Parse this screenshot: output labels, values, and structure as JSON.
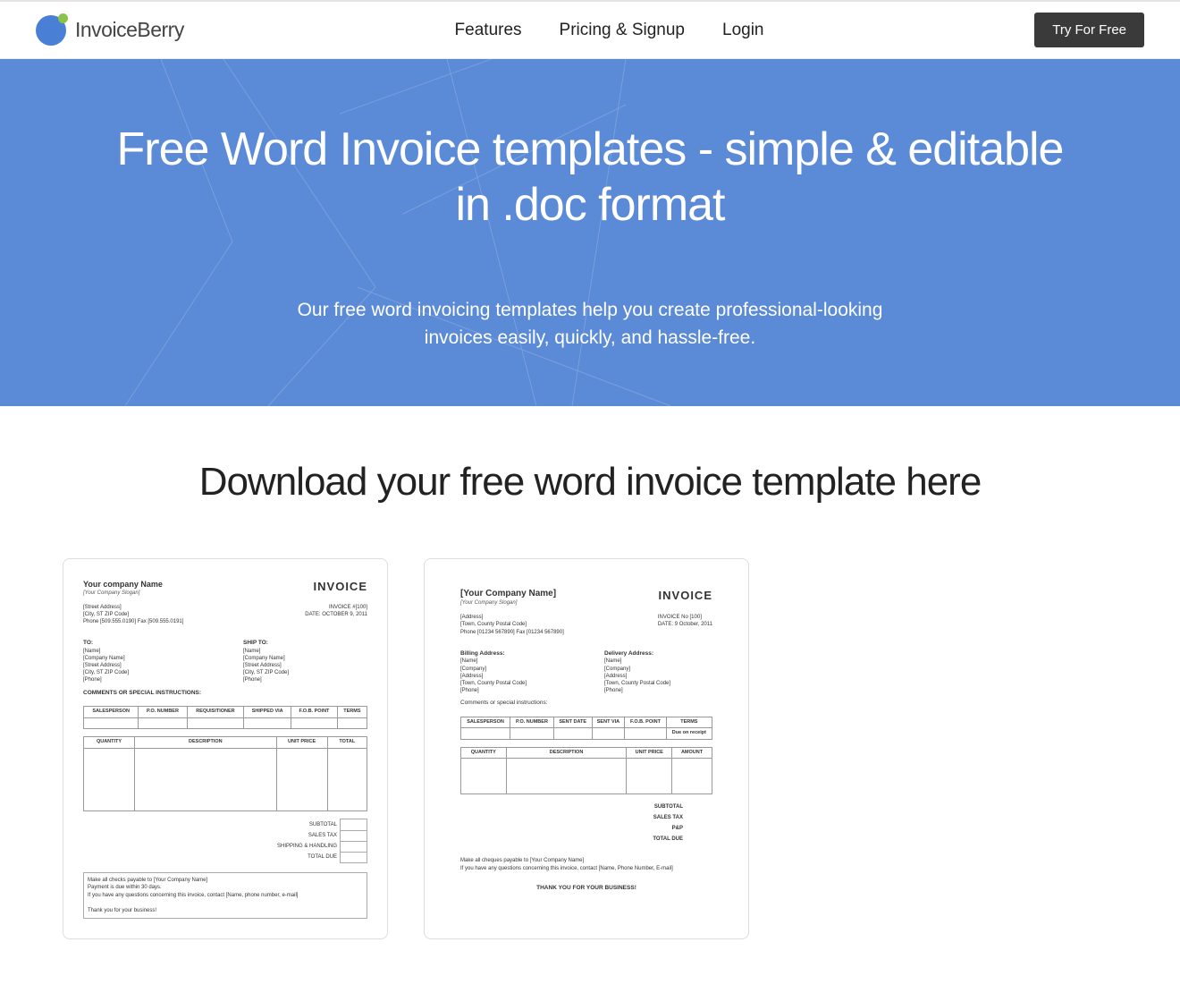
{
  "brand": {
    "name": "InvoiceBerry"
  },
  "nav": {
    "features": "Features",
    "pricing": "Pricing & Signup",
    "login": "Login",
    "cta": "Try For Free"
  },
  "hero": {
    "title": "Free Word Invoice templates - simple & editable in .doc format",
    "subtitle": "Our free word invoicing templates help you create professional-looking invoices easily, quickly, and hassle-free."
  },
  "section": {
    "heading": "Download your free word invoice template here"
  },
  "template1": {
    "company_name": "Your company Name",
    "slogan": "[Your Company Slogan]",
    "addr1": "[Street Address]",
    "addr2": "[City, ST  ZIP Code]",
    "phone_fax": "Phone [509.555.0190]  Fax [509.555.0191]",
    "invoice_word": "INVOICE",
    "invoice_no_label": "INVOICE #[100]",
    "date_label": "DATE: OCTOBER 9, 2011",
    "to_label": "TO:",
    "ship_label": "SHIP TO:",
    "field_name": "[Name]",
    "field_company": "[Company Name]",
    "field_street": "[Street Address]",
    "field_city": "[City, ST  ZIP Code]",
    "field_phone": "[Phone]",
    "comments_label": "COMMENTS OR SPECIAL INSTRUCTIONS:",
    "th_sales": "SALESPERSON",
    "th_po": "P.O. NUMBER",
    "th_req": "REQUISITIONER",
    "th_ship": "SHIPPED VIA",
    "th_fob": "F.O.B. POINT",
    "th_terms": "TERMS",
    "th_qty": "QUANTITY",
    "th_desc": "DESCRIPTION",
    "th_unit": "UNIT PRICE",
    "th_total": "TOTAL",
    "tot_sub": "SUBTOTAL",
    "tot_tax": "SALES TAX",
    "tot_ship": "SHIPPING & HANDLING",
    "tot_due": "TOTAL DUE",
    "foot1": "Make all checks payable to [Your Company Name]",
    "foot2": "Payment is due within 30 days.",
    "foot3": "If you have any questions concerning this invoice, contact [Name, phone number, e-mail]",
    "foot4": "Thank you for your business!"
  },
  "template2": {
    "company_name": "[Your Company Name]",
    "slogan": "[Your Company Slogan]",
    "addr_label": "[Address]",
    "town": "[Town, County  Postal Code]",
    "phone_fax": "Phone [01234 567890] Fax [01234 567890]",
    "invoice_word": "INVOICE",
    "invoice_no_label": "INVOICE No [100]",
    "date_label": "DATE:  9 October, 2011",
    "bill_label": "Billing Address:",
    "deliv_label": "Delivery Address:",
    "field_name": "[Name]",
    "field_company": "[Company]",
    "field_address": "[Address]",
    "field_town": "[Town, County  Postal Code]",
    "field_phone": "[Phone]",
    "comments_label": "Comments or special instructions:",
    "th_sales": "SALESPERSON",
    "th_po": "P.O. NUMBER",
    "th_sent_date": "SENT DATE",
    "th_sent_via": "SENT VIA",
    "th_fob": "F.O.B. POINT",
    "th_terms": "TERMS",
    "terms_value": "Due on receipt",
    "th_qty": "QUANTITY",
    "th_desc": "DESCRIPTION",
    "th_unit": "UNIT PRICE",
    "th_amount": "AMOUNT",
    "tot_sub": "SUBTOTAL",
    "tot_tax": "SALES TAX",
    "tot_pp": "P&P",
    "tot_due": "TOTAL DUE",
    "foot1": "Make all cheques payable to [Your Company Name]",
    "foot2": "If you have any questions concerning this invoice, contact [Name, Phone Number, E-mail]",
    "thankyou": "THANK YOU FOR YOUR BUSINESS!"
  }
}
